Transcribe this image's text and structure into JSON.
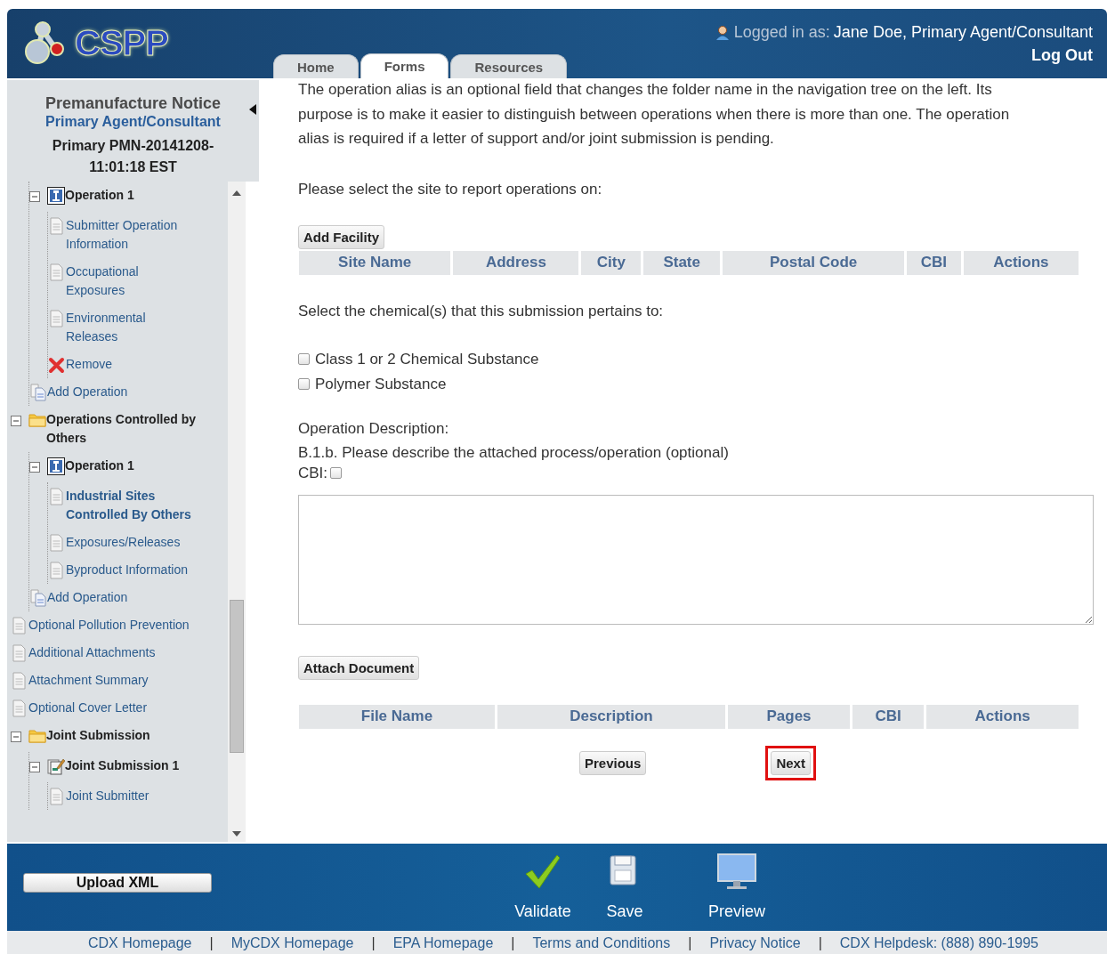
{
  "header": {
    "logo": "CSPP",
    "user_label": "Logged in as:",
    "user_name": "Jane Doe, Primary Agent/Consultant",
    "logout": "Log Out"
  },
  "tabs": [
    {
      "label": "Home",
      "selected": false
    },
    {
      "label": "Forms",
      "selected": true
    },
    {
      "label": "Resources",
      "selected": false
    }
  ],
  "sidebar": {
    "title": "Premanufacture Notice",
    "subtitle": "Primary Agent/Consultant",
    "submission": "Primary PMN-20141208-11:01:18 EST",
    "tree": [
      {
        "kind": "branch",
        "children": [
          {
            "label": "Operation 1",
            "kind": "operation",
            "selected": false,
            "expanded": true,
            "children": [
              {
                "label": "Submitter Operation Information",
                "kind": "page",
                "selected": false
              },
              {
                "label": "Occupational Exposures",
                "kind": "page",
                "selected": false
              },
              {
                "label": "Environmental Releases",
                "kind": "page",
                "selected": false
              },
              {
                "label": "Remove",
                "kind": "remove",
                "selected": false
              }
            ]
          },
          {
            "label": "Add Operation",
            "kind": "add",
            "selected": false
          }
        ]
      },
      {
        "label": "Operations Controlled by Others",
        "kind": "folder",
        "selected": false,
        "expanded": true,
        "children": [
          {
            "label": "Operation 1",
            "kind": "operation",
            "selected": false,
            "expanded": true,
            "children": [
              {
                "label": "Industrial Sites Controlled By Others",
                "kind": "page",
                "selected": true
              },
              {
                "label": "Exposures/Releases",
                "kind": "page",
                "selected": false
              },
              {
                "label": "Byproduct Information",
                "kind": "page",
                "selected": false
              }
            ]
          },
          {
            "label": "Add Operation",
            "kind": "add",
            "selected": false
          }
        ]
      },
      {
        "label": "Optional Pollution Prevention",
        "kind": "page",
        "selected": false
      },
      {
        "label": "Additional Attachments",
        "kind": "page",
        "selected": false
      },
      {
        "label": "Attachment Summary",
        "kind": "page",
        "selected": false
      },
      {
        "label": "Optional Cover Letter",
        "kind": "page",
        "selected": false
      },
      {
        "label": "Joint Submission",
        "kind": "folder",
        "selected": false,
        "expanded": true,
        "children": [
          {
            "label": "Joint Submission 1",
            "kind": "joint",
            "selected": false,
            "expanded": true,
            "children": [
              {
                "label": "Joint Submitter",
                "kind": "page",
                "selected": false
              }
            ]
          }
        ]
      }
    ]
  },
  "form": {
    "intro": "The operation alias is an optional field that changes the folder name in the navigation tree on the left. Its purpose is to make it easier to distinguish between operations when there is more than one. The operation alias is required if a letter of support and/or joint submission is pending.",
    "site_prompt": "Please select the site to report operations on:",
    "add_facility": "Add Facility",
    "site_columns": [
      "Site Name",
      "Address",
      "City",
      "State",
      "Postal Code",
      "CBI",
      "Actions"
    ],
    "chemical_prompt": "Select the chemical(s) that this submission pertains to:",
    "chemicals": [
      {
        "label": "Class 1 or 2 Chemical Substance",
        "checked": false
      },
      {
        "label": "Polymer Substance",
        "checked": false
      }
    ],
    "description_label": "Operation Description:",
    "description_question": "B.1.b. Please describe the attached process/operation (optional)",
    "cbi": {
      "label": "CBI:",
      "checked": false
    },
    "attach_document": "Attach Document",
    "document_columns": [
      "File Name",
      "Description",
      "Pages",
      "CBI",
      "Actions"
    ],
    "nav_buttons": [
      {
        "label": "Previous",
        "highlighted": false
      },
      {
        "label": "Next",
        "highlighted": true
      }
    ]
  },
  "action_bar": {
    "upload": "Upload XML",
    "actions": [
      {
        "kind": "validate",
        "label": "Validate"
      },
      {
        "kind": "save",
        "label": "Save"
      },
      {
        "kind": "preview",
        "label": "Preview"
      }
    ]
  },
  "footer_links": [
    {
      "kind": "link",
      "text": "CDX Homepage"
    },
    {
      "kind": "separator",
      "text": "|"
    },
    {
      "kind": "link",
      "text": "MyCDX Homepage"
    },
    {
      "kind": "separator",
      "text": "|"
    },
    {
      "kind": "link",
      "text": "EPA Homepage"
    },
    {
      "kind": "separator",
      "text": "|"
    },
    {
      "kind": "link",
      "text": "Terms and Conditions"
    },
    {
      "kind": "separator",
      "text": "|"
    },
    {
      "kind": "link",
      "text": "Privacy Notice"
    },
    {
      "kind": "separator",
      "text": "|"
    },
    {
      "kind": "link",
      "text": "CDX Helpdesk: (888) 890-1995"
    }
  ]
}
